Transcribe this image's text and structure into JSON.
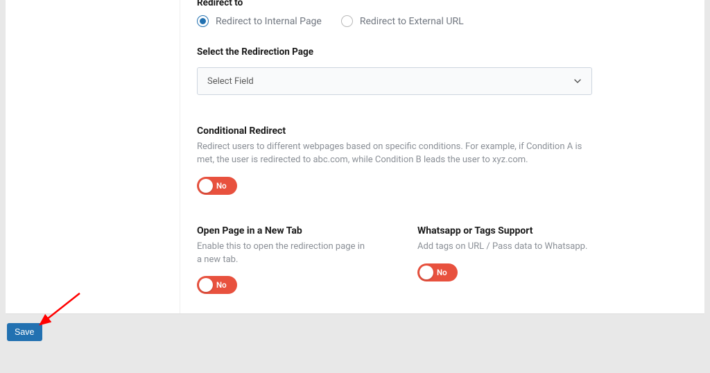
{
  "redirect_to": {
    "label": "Redirect to",
    "options": [
      {
        "label": "Redirect to Internal Page",
        "selected": true
      },
      {
        "label": "Redirect to External URL",
        "selected": false
      }
    ]
  },
  "select_page": {
    "label": "Select the Redirection Page",
    "value": "Select Field"
  },
  "conditional_redirect": {
    "title": "Conditional Redirect",
    "desc": "Redirect users to different webpages based on specific conditions. For example, if Condition A is met, the user is redirected to abc.com, while Condition B leads the user to xyz.com.",
    "toggle_text": "No"
  },
  "new_tab": {
    "title": "Open Page in a New Tab",
    "desc": "Enable this to open the redirection page in a new tab.",
    "toggle_text": "No"
  },
  "whatsapp": {
    "title": "Whatsapp or Tags Support",
    "desc": "Add tags on URL / Pass data to Whatsapp.",
    "toggle_text": "No"
  },
  "save_label": "Save"
}
